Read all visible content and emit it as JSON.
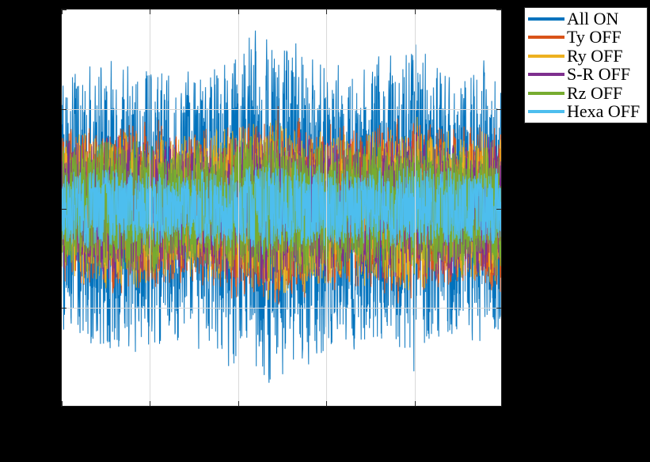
{
  "figure": {
    "background_color": "#000000",
    "axes_background_color": "#ffffff",
    "axes_border_color": "#1a1a1a",
    "grid_color": "#d9d9d9"
  },
  "legend": {
    "position": "northeast-outside",
    "background_color": "#ffffff",
    "border_color": "#2b2b2b",
    "entries": [
      {
        "label": "All ON",
        "color": "#0072BD"
      },
      {
        "label": "Ty OFF",
        "color": "#D95319"
      },
      {
        "label": "Ry OFF",
        "color": "#EDB120"
      },
      {
        "label": "S-R OFF",
        "color": "#7E2F8E"
      },
      {
        "label": "Rz OFF",
        "color": "#77AC30"
      },
      {
        "label": "Hexa OFF",
        "color": "#4DBEEE"
      }
    ]
  },
  "chart_data": {
    "type": "line",
    "title": "",
    "xlabel": "",
    "ylabel": "",
    "grid": true,
    "xlim": [
      0,
      1
    ],
    "ylim": [
      -1,
      1
    ],
    "x_gridlines": [
      0.2,
      0.4,
      0.6,
      0.8
    ],
    "y_gridlines": [
      0.5,
      -0.5
    ],
    "x_ticks": [
      0,
      0.2,
      0.4,
      0.6,
      0.8,
      1
    ],
    "y_ticks": [
      -1,
      -0.5,
      0,
      0.5,
      1
    ],
    "x_tick_labels": [],
    "y_tick_labels": [],
    "description": "Six overlaid high-density noisy time traces; envelope amplitude decreases per series so later series are drawn on top forming a solid central band.",
    "n_points": 2000,
    "series": [
      {
        "name": "All ON",
        "color": "#0072BD",
        "z_order": 1,
        "rms_amplitude": 0.62,
        "peak_amplitude": 0.96,
        "envelope_profile": [
          0.74,
          0.8,
          0.86,
          0.82,
          0.76,
          0.8,
          0.92,
          1.0,
          0.94,
          0.84,
          0.8,
          0.86,
          0.9,
          0.82,
          0.78,
          0.84
        ]
      },
      {
        "name": "Ty OFF",
        "color": "#D95319",
        "z_order": 2,
        "rms_amplitude": 0.45,
        "peak_amplitude": 0.7,
        "envelope_profile": [
          0.6,
          0.64,
          0.68,
          0.64,
          0.6,
          0.63,
          0.7,
          0.74,
          0.7,
          0.66,
          0.63,
          0.67,
          0.7,
          0.64,
          0.62,
          0.66
        ]
      },
      {
        "name": "Ry OFF",
        "color": "#EDB120",
        "z_order": 3,
        "rms_amplitude": 0.43,
        "peak_amplitude": 0.68,
        "envelope_profile": [
          0.58,
          0.62,
          0.66,
          0.62,
          0.58,
          0.61,
          0.68,
          0.72,
          0.68,
          0.64,
          0.61,
          0.65,
          0.68,
          0.62,
          0.6,
          0.64
        ]
      },
      {
        "name": "S-R OFF",
        "color": "#7E2F8E",
        "z_order": 4,
        "rms_amplitude": 0.41,
        "peak_amplitude": 0.64,
        "envelope_profile": [
          0.55,
          0.59,
          0.63,
          0.59,
          0.55,
          0.58,
          0.64,
          0.68,
          0.64,
          0.6,
          0.58,
          0.62,
          0.64,
          0.59,
          0.57,
          0.61
        ]
      },
      {
        "name": "Rz OFF",
        "color": "#77AC30",
        "z_order": 5,
        "rms_amplitude": 0.4,
        "peak_amplitude": 0.62,
        "envelope_profile": [
          0.53,
          0.57,
          0.61,
          0.57,
          0.53,
          0.56,
          0.62,
          0.66,
          0.62,
          0.58,
          0.56,
          0.6,
          0.62,
          0.57,
          0.55,
          0.59
        ]
      },
      {
        "name": "Hexa OFF",
        "color": "#4DBEEE",
        "z_order": 6,
        "rms_amplitude": 0.3,
        "peak_amplitude": 0.5,
        "envelope_profile": [
          0.42,
          0.45,
          0.48,
          0.45,
          0.42,
          0.44,
          0.49,
          0.52,
          0.49,
          0.46,
          0.44,
          0.47,
          0.49,
          0.45,
          0.43,
          0.46
        ]
      }
    ]
  }
}
